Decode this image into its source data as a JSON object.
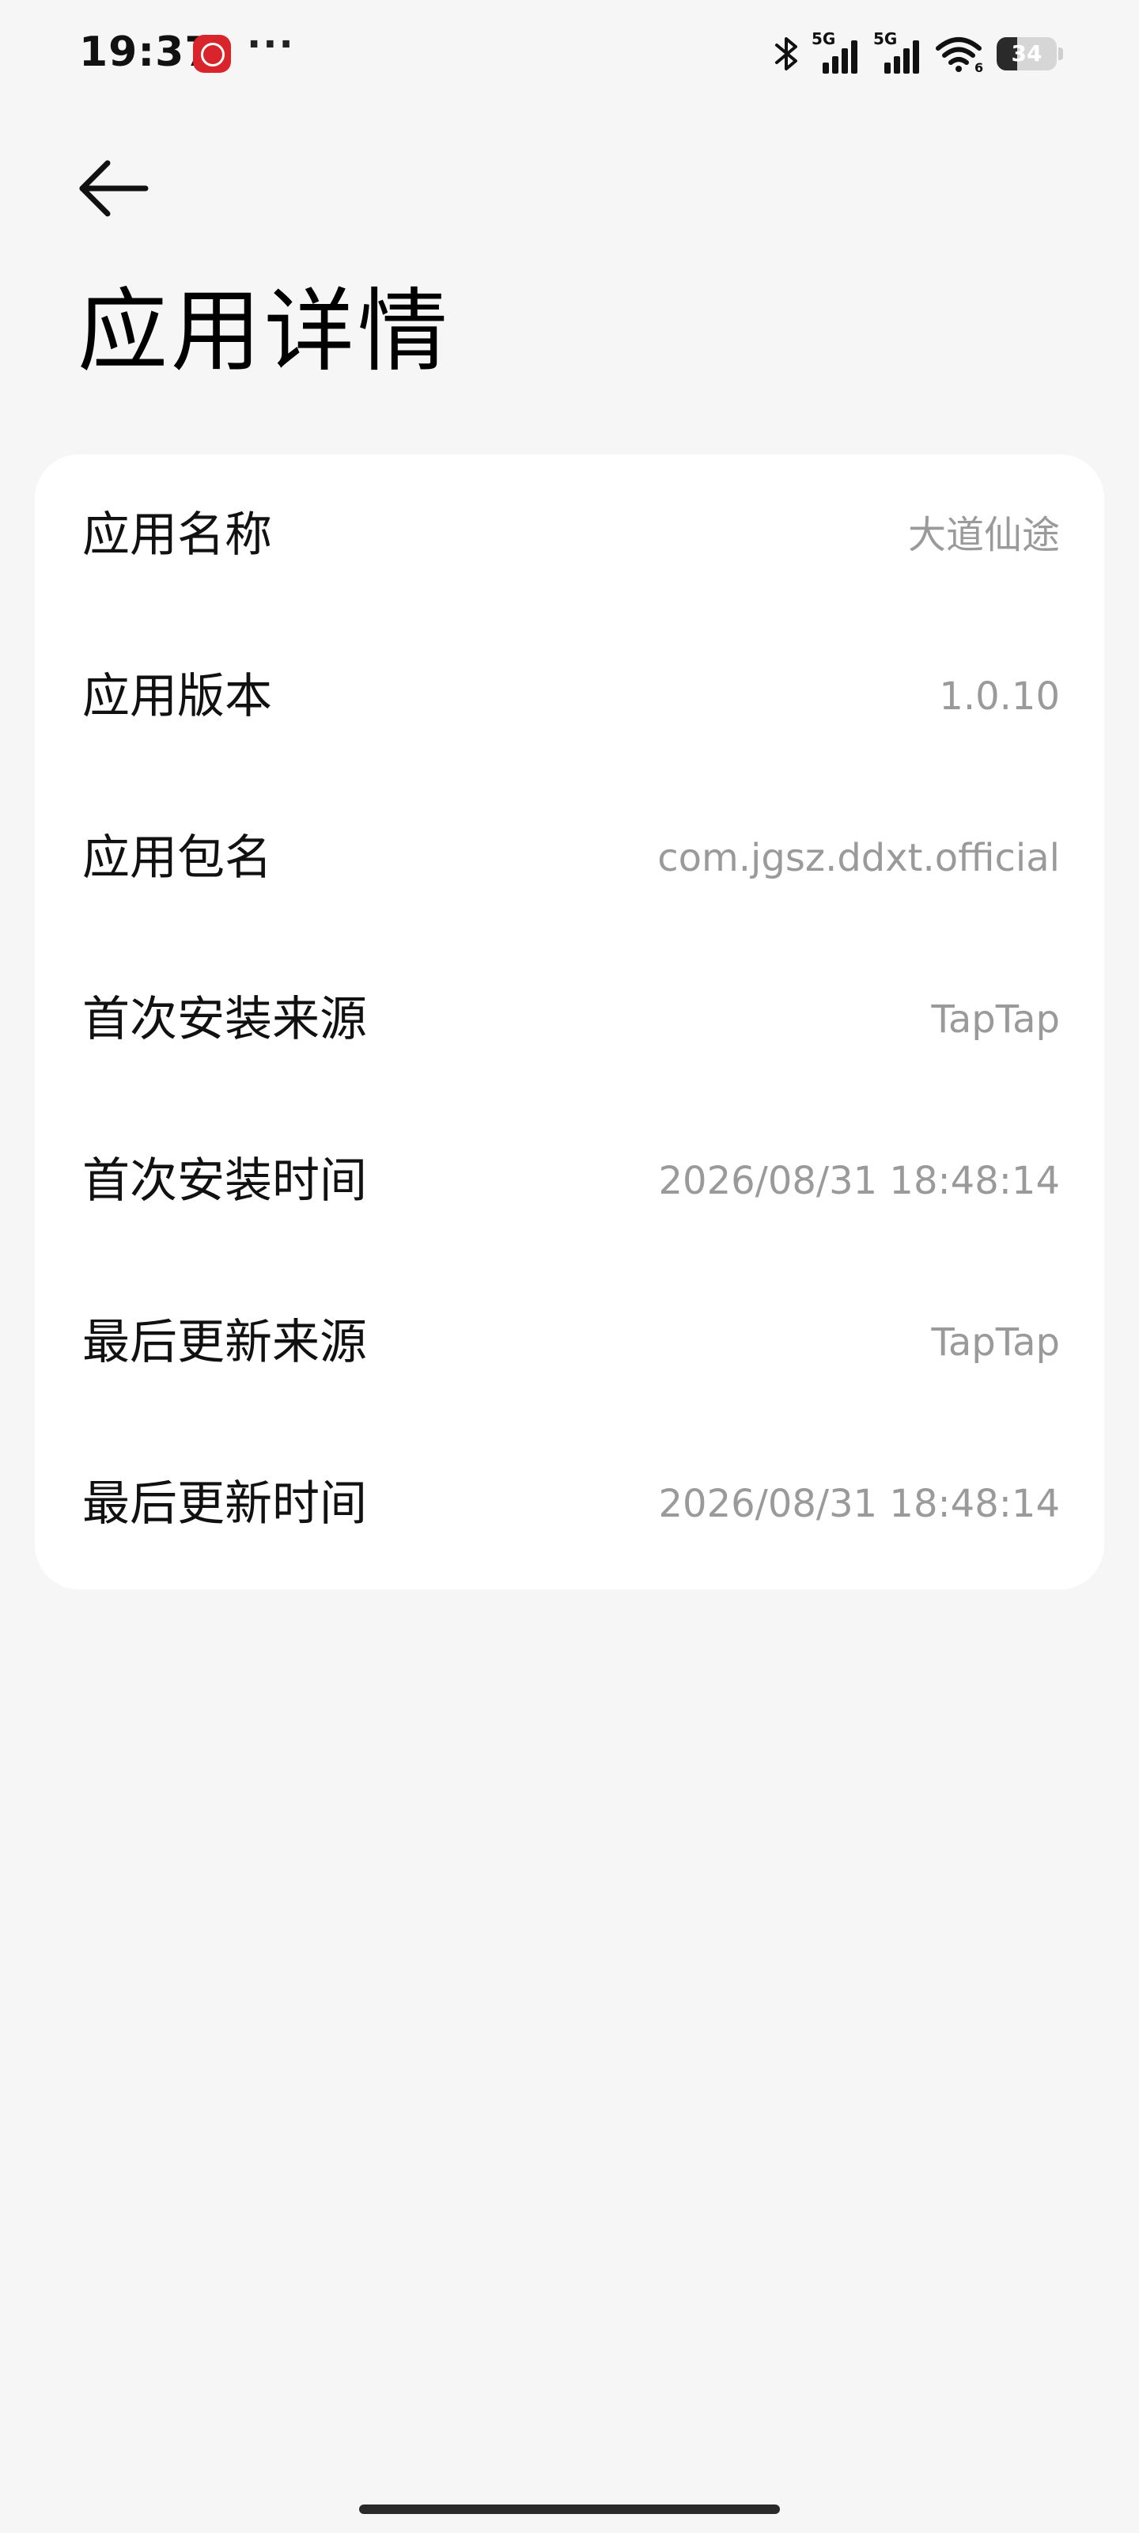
{
  "status_bar": {
    "time": "19:37",
    "battery": 34,
    "battery_text": "34",
    "signal_1_tag": "5G",
    "signal_2_tag": "5G",
    "wifi_badge": "6",
    "more_text": "···",
    "icons": [
      "notification-app-icon",
      "bluetooth-icon",
      "signal-5g-icon",
      "signal-5g-icon",
      "wifi-icon",
      "battery-icon"
    ]
  },
  "header": {
    "back_icon": "back-arrow-icon",
    "title": "应用详情"
  },
  "details": {
    "rows": [
      {
        "label": "应用名称",
        "value": "大道仙途"
      },
      {
        "label": "应用版本",
        "value": "1.0.10"
      },
      {
        "label": "应用包名",
        "value": "com.jgsz.ddxt.official"
      },
      {
        "label": "首次安装来源",
        "value": "TapTap"
      },
      {
        "label": "首次安装时间",
        "value": "2026/08/31 18:48:14"
      },
      {
        "label": "最后更新来源",
        "value": "TapTap"
      },
      {
        "label": "最后更新时间",
        "value": "2026/08/31 18:48:14"
      }
    ]
  },
  "colors": {
    "background": "#f6f6f6",
    "card": "#ffffff",
    "label": "#111111",
    "value": "#9a9a9a",
    "notification_icon": "#d9242b"
  }
}
